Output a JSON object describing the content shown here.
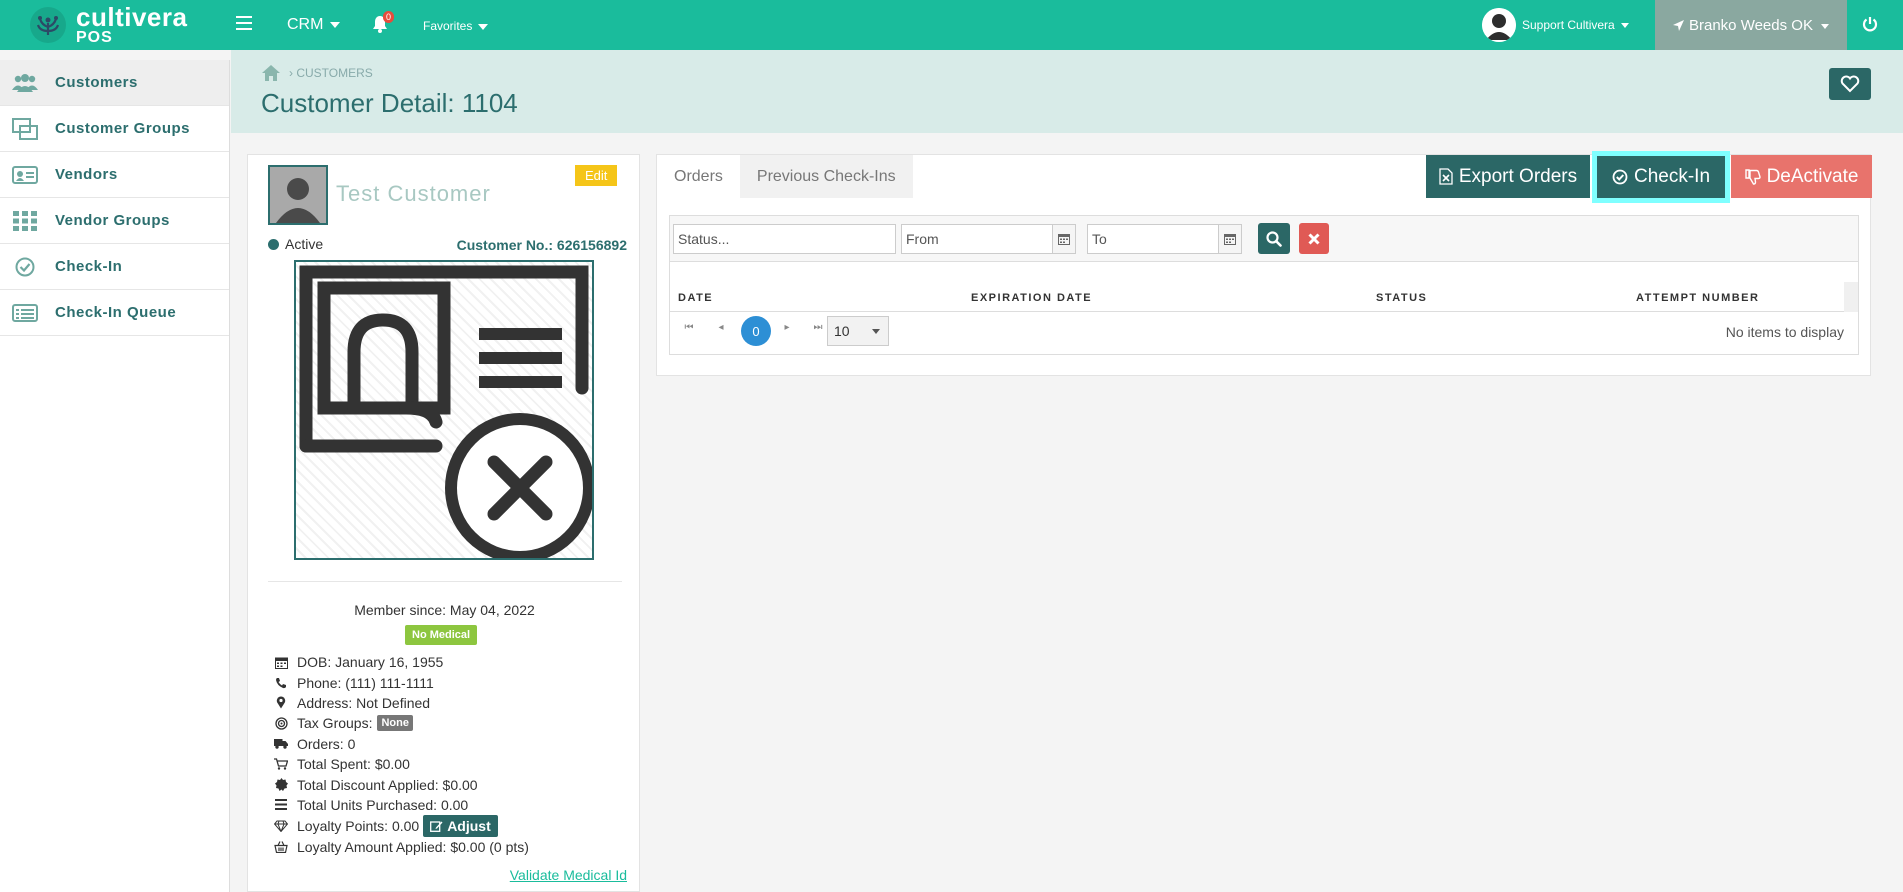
{
  "topbar": {
    "logo_line1": "cultivera",
    "logo_line2": "POS",
    "crm_label": "CRM",
    "notification_count": "0",
    "favorites_label": "Favorites",
    "user_name": "Support Cultivera",
    "store_name": "Branko Weeds OK",
    "bg_color": "#1abc9c"
  },
  "sidebar": {
    "items": [
      {
        "label": "Customers",
        "icon": "users-icon"
      },
      {
        "label": "Customer Groups",
        "icon": "groups-icon"
      },
      {
        "label": "Vendors",
        "icon": "id-card-icon"
      },
      {
        "label": "Vendor Groups",
        "icon": "grid-icon"
      },
      {
        "label": "Check-In",
        "icon": "check-circle-icon"
      },
      {
        "label": "Check-In Queue",
        "icon": "list-icon"
      }
    ]
  },
  "header": {
    "breadcrumb": "CUSTOMERS",
    "title": "Customer Detail: 1104"
  },
  "customer": {
    "name": "Test Customer",
    "edit_label": "Edit",
    "status": "Active",
    "customer_no": "Customer No.: 626156892",
    "member_since": "Member since: May 04, 2022",
    "medical_badge": "No Medical",
    "dob": "DOB: January 16, 1955",
    "phone": "Phone: (111) 111-1111",
    "address": "Address: Not Defined",
    "tax_groups": "Tax Groups:",
    "tax_groups_value": "None",
    "orders": "Orders: 0",
    "total_spent": "Total Spent: $0.00",
    "total_discount": "Total Discount Applied: $0.00",
    "total_units": "Total Units Purchased: 0.00",
    "loyalty_points": "Loyalty Points: 0.00",
    "adjust_label": "Adjust",
    "loyalty_amount": "Loyalty Amount Applied: $0.00 (0 pts)",
    "validate_link": "Validate Medical Id"
  },
  "panel": {
    "tabs": [
      {
        "label": "Orders"
      },
      {
        "label": "Previous Check-Ins"
      }
    ],
    "export_label": "Export Orders",
    "checkin_label": "Check-In",
    "deactivate_label": "DeActivate",
    "filters": {
      "status_placeholder": "Status...",
      "from_placeholder": "From",
      "to_placeholder": "To"
    },
    "columns": [
      "DATE",
      "EXPIRATION DATE",
      "STATUS",
      "ATTEMPT NUMBER"
    ],
    "pager": {
      "current_page": "0",
      "page_size": "10",
      "empty_text": "No items to display"
    }
  }
}
